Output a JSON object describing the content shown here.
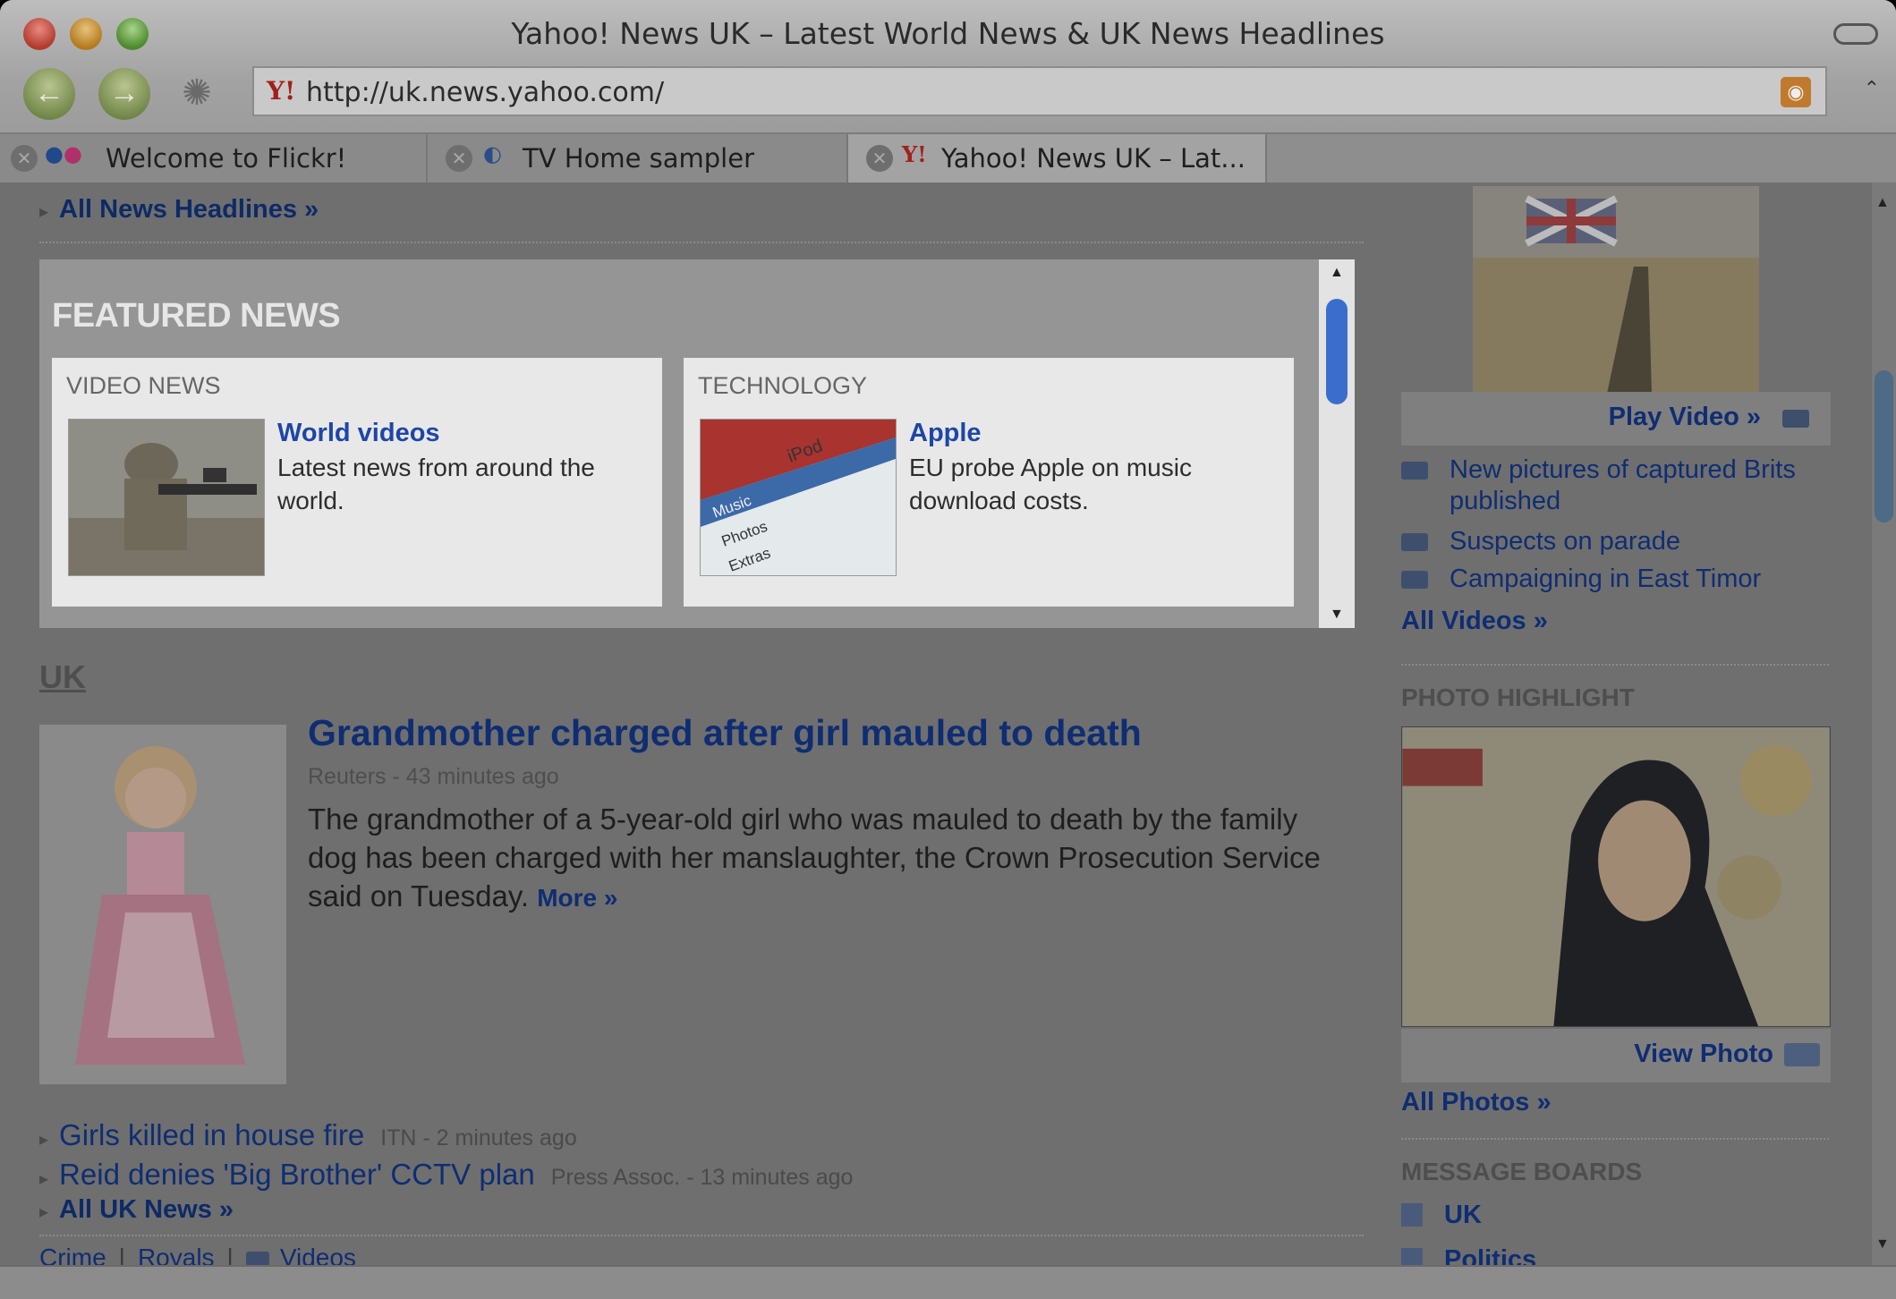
{
  "window": {
    "title": "Yahoo! News UK – Latest World News & UK News Headlines"
  },
  "toolbar": {
    "url": "http://uk.news.yahoo.com/",
    "back_glyph": "←",
    "forward_glyph": "→"
  },
  "tabs": [
    {
      "label": "Welcome to Flickr!",
      "icon": "flickr-icon"
    },
    {
      "label": "TV Home sampler",
      "icon": "tv-sampler-icon"
    },
    {
      "label": "Yahoo! News UK – Lat...",
      "icon": "yahoo-icon",
      "active": true
    }
  ],
  "page": {
    "all_news_link": "All News Headlines »",
    "featured": {
      "title": "FEATURED NEWS",
      "cards": [
        {
          "kicker": "VIDEO NEWS",
          "headline": "World videos",
          "description": "Latest news from around the world."
        },
        {
          "kicker": "TECHNOLOGY",
          "headline": "Apple",
          "description": "EU probe Apple on music download costs."
        }
      ]
    },
    "uk": {
      "section_title": "UK",
      "headline": "Grandmother charged after girl mauled to death",
      "source": "Reuters - 43 minutes ago",
      "body": "The grandmother of a 5-year-old girl who was mauled to death by the family dog has been charged with her manslaughter, the Crown Prosecution Service said on Tuesday.",
      "more": "More »",
      "items": [
        {
          "title": "Girls killed in house fire",
          "meta": "ITN - 2 minutes ago"
        },
        {
          "title": "Reid denies 'Big Brother' CCTV plan",
          "meta": "Press Assoc. - 13 minutes ago"
        }
      ],
      "all_link": "All UK News »",
      "categories": [
        "Crime",
        "Royals",
        "Videos"
      ]
    },
    "sidebar": {
      "play_video": "Play Video »",
      "videos": [
        "New pictures of captured Brits published",
        "Suspects on parade",
        "Campaigning in East Timor"
      ],
      "all_videos": "All Videos »",
      "photo_heading": "PHOTO HIGHLIGHT",
      "view_photo": "View Photo",
      "all_photos": "All Photos »",
      "boards_heading": "MESSAGE BOARDS",
      "boards": [
        "UK",
        "Politics"
      ]
    }
  },
  "colors": {
    "link": "#0f2d72",
    "yahoo_red": "#a1201a",
    "dim_overlay": "#6f6f6f"
  }
}
